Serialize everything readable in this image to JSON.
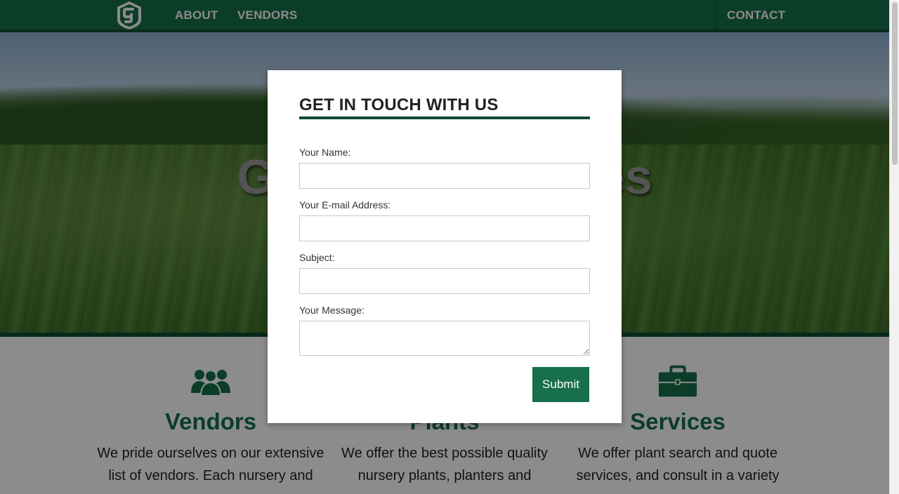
{
  "nav": {
    "about": "ABOUT",
    "vendors": "VENDORS",
    "contact": "CONTACT",
    "logo_icon": "g-shield-logo"
  },
  "hero": {
    "title": "Growing Services"
  },
  "features": [
    {
      "icon": "users-icon",
      "title": "Vendors",
      "text": "We pride ourselves on our extensive list of vendors. Each nursery and"
    },
    {
      "icon": "plant-icon",
      "title": "Plants",
      "text": "We offer the best possible quality nursery plants, planters and"
    },
    {
      "icon": "briefcase-icon",
      "title": "Services",
      "text": "We offer plant search and quote services, and consult in a variety"
    }
  ],
  "modal": {
    "title": "GET IN TOUCH WITH US",
    "name_label": "Your Name:",
    "email_label": "Your E-mail Address:",
    "subject_label": "Subject:",
    "message_label": "Your Message:",
    "name_value": "",
    "email_value": "",
    "subject_value": "",
    "message_value": "",
    "submit": "Submit"
  },
  "colors": {
    "brand_green": "#176f4b",
    "dark_green": "#0f4d33"
  }
}
